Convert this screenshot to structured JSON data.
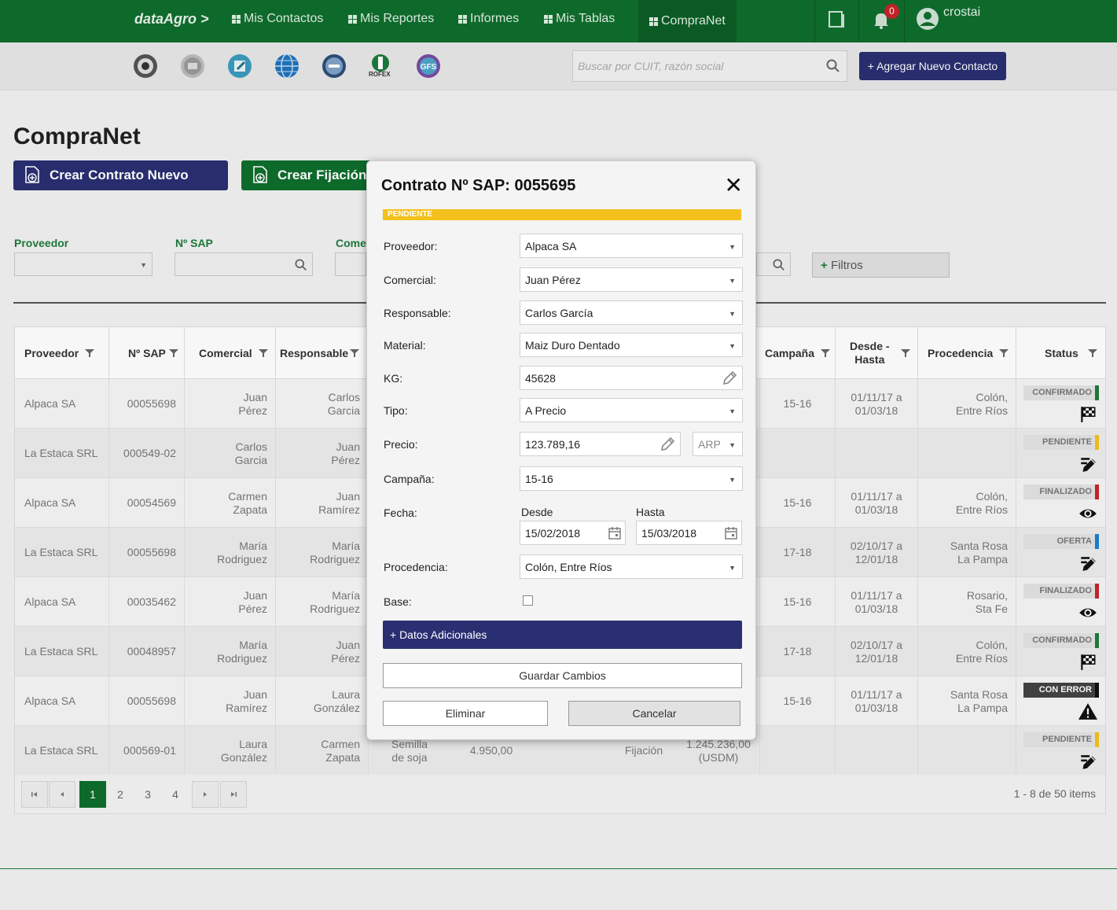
{
  "nav": {
    "brand": "dataAgro >",
    "items": [
      {
        "label": "Mis Contactos"
      },
      {
        "label": "Mis Reportes"
      },
      {
        "label": "Informes"
      },
      {
        "label": "Mis Tablas"
      },
      {
        "label": "CompraNet"
      }
    ],
    "notifications_count": "0",
    "username": "crostai",
    "colors": {
      "primary": "#0f6e2d",
      "accent": "#2a2f72"
    }
  },
  "subheader": {
    "logos": [
      "logo-circle-1-icon",
      "logo-circle-2-icon",
      "edit-circle-icon",
      "globe-icon",
      "logo-circle-3-icon",
      "rofex-icon",
      "gfs-icon"
    ],
    "rofex_label": "ROFEX",
    "gfs_label": "GFS",
    "search_placeholder": "Buscar por CUIT, razón social",
    "add_contact_label": "+ Agregar Nuevo Contacto"
  },
  "page": {
    "title": "CompraNet",
    "btn_new_contract": "Crear Contrato Nuevo",
    "btn_new_fixation": "Crear Fijación",
    "filters": {
      "proveedor": "Proveedor",
      "nsap": "Nº SAP",
      "comercial": "Come",
      "more": "Filtros",
      "more_plus": "+"
    }
  },
  "table": {
    "headers": [
      "Proveedor",
      "Nº SAP",
      "Comercial",
      "Responsable",
      "Campaña",
      "Desde -\nHasta",
      "Procedencia",
      "Status"
    ],
    "rows": [
      {
        "proveedor": "Alpaca SA",
        "sap": "00055698",
        "comercial": "Juan\nPérez",
        "responsable": "Carlos\nGarcia",
        "campana": "15-16",
        "fecha": "01/11/17 a\n01/03/18",
        "procedencia": "Colón,\nEntre Ríos",
        "status": "CONFIRMADO",
        "status_color": "#1e7a3b",
        "status_icon": "checkered-flag-icon"
      },
      {
        "proveedor": "La Estaca SRL",
        "sap": "000549-02",
        "comercial": "Carlos\nGarcia",
        "responsable": "Juan\nPérez",
        "campana": "",
        "fecha": "",
        "procedencia": "",
        "status": "PENDIENTE",
        "status_color": "#f4c01c",
        "status_icon": "edit-icon"
      },
      {
        "proveedor": "Alpaca SA",
        "sap": "00054569",
        "comercial": "Carmen\nZapata",
        "responsable": "Juan\nRamírez",
        "campana": "15-16",
        "fecha": "01/11/17 a\n01/03/18",
        "procedencia": "Colón,\nEntre Ríos",
        "status": "FINALIZADO",
        "status_color": "#c7242b",
        "status_icon": "eye-icon"
      },
      {
        "proveedor": "La Estaca SRL",
        "sap": "00055698",
        "comercial": "María\nRodriguez",
        "responsable": "María\nRodriguez",
        "campana": "17-18",
        "fecha": "02/10/17 a\n12/01/18",
        "procedencia": "Santa Rosa\nLa Pampa",
        "status": "OFERTA",
        "status_color": "#1a7fd0",
        "status_icon": "edit-icon"
      },
      {
        "proveedor": "Alpaca SA",
        "sap": "00035462",
        "comercial": "Juan\nPérez",
        "responsable": "María\nRodriguez",
        "campana": "15-16",
        "fecha": "01/11/17 a\n01/03/18",
        "procedencia": "Rosario,\nSta Fe",
        "status": "FINALIZADO",
        "status_color": "#c7242b",
        "status_icon": "eye-icon"
      },
      {
        "proveedor": "La Estaca SRL",
        "sap": "00048957",
        "comercial": "María\nRodriguez",
        "responsable": "Juan\nPérez",
        "campana": "17-18",
        "fecha": "02/10/17 a\n12/01/18",
        "procedencia": "Colón,\nEntre Ríos",
        "status": "CONFIRMADO",
        "status_color": "#1e7a3b",
        "status_icon": "checkered-flag-icon"
      },
      {
        "proveedor": "Alpaca SA",
        "sap": "00055698",
        "comercial": "Juan\nRamírez",
        "responsable": "Laura\nGonzález",
        "campana": "15-16",
        "fecha": "01/11/17 a\n01/03/18",
        "procedencia": "Santa Rosa\nLa Pampa",
        "status": "CON ERROR",
        "status_color": "#111111",
        "status_icon": "warning-icon"
      },
      {
        "proveedor": "La Estaca SRL",
        "sap": "000569-01",
        "comercial": "Laura\nGonzález",
        "responsable": "Carmen\nZapata",
        "campana": "",
        "fecha": "",
        "procedencia": "",
        "status": "PENDIENTE",
        "status_color": "#f4c01c",
        "status_icon": "edit-icon"
      }
    ],
    "hidden_row8": {
      "material": "Semilla\nde soja",
      "kg": "4.950,00",
      "tipo": "Fijación",
      "precio": "1.245.236,00\n(USDM)"
    }
  },
  "pager": {
    "pages": [
      "1",
      "2",
      "3",
      "4"
    ],
    "current": "1",
    "info": "1 - 8 de 50 items"
  },
  "modal": {
    "title": "Contrato Nº SAP: 0055695",
    "close": "✕",
    "status": "PENDIENTE",
    "status_color": "#f4c01c",
    "fields": {
      "proveedor": {
        "label": "Proveedor:",
        "value": "Alpaca SA"
      },
      "comercial": {
        "label": "Comercial:",
        "value": "Juan Pérez"
      },
      "responsable": {
        "label": "Responsable:",
        "value": "Carlos García"
      },
      "material": {
        "label": "Material:",
        "value": "Maiz Duro Dentado"
      },
      "kg": {
        "label": "KG:",
        "value": "45628"
      },
      "tipo": {
        "label": "Tipo:",
        "value": "A Precio"
      },
      "precio": {
        "label": "Precio:",
        "value": "123.789,16",
        "currency": "ARP"
      },
      "campana": {
        "label": "Campaña:",
        "value": "15-16"
      },
      "fecha": {
        "label": "Fecha:",
        "desde_label": "Desde",
        "hasta_label": "Hasta",
        "desde": "15/02/2018",
        "hasta": "15/03/2018"
      },
      "procedencia": {
        "label": "Procedencia:",
        "value": "Colón, Entre Ríos"
      },
      "base": {
        "label": "Base:",
        "checked": false
      }
    },
    "datos_adicionales": "+ Datos Adicionales",
    "guardar": "Guardar Cambios",
    "eliminar": "Eliminar",
    "cancelar": "Cancelar"
  }
}
